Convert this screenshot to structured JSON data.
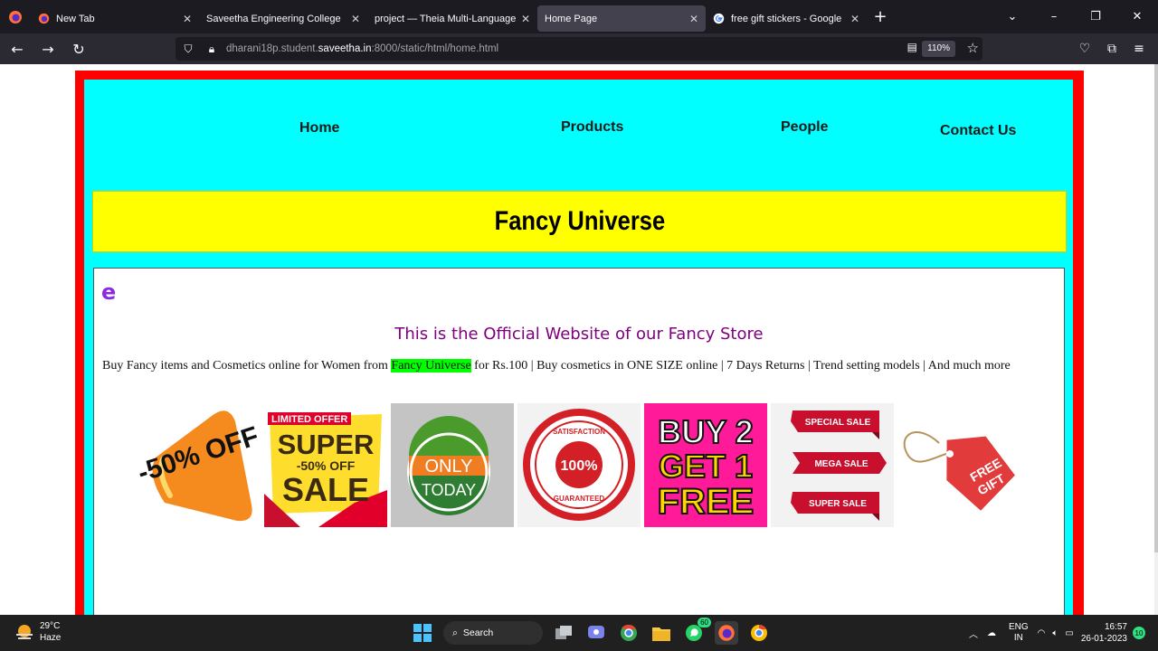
{
  "browser": {
    "tabs": [
      {
        "label": "New Tab",
        "favicon": "firefox-icon"
      },
      {
        "label": "Saveetha Engineering College",
        "favicon": "blank"
      },
      {
        "label": "project — Theia Multi-Language Ex",
        "favicon": "blank"
      },
      {
        "label": "Home Page",
        "favicon": "blank",
        "active": true
      },
      {
        "label": "free gift stickers - Google Searc",
        "favicon": "google-icon"
      }
    ],
    "url_prefix": "dharani18p.student.",
    "url_domain": "saveetha.in",
    "url_suffix": ":8000/static/html/home.html",
    "zoom": "110%"
  },
  "page": {
    "menu": [
      "Home",
      "Products",
      "People",
      "Contact Us"
    ],
    "banner_title": "Fancy Universe",
    "marquee_text": "e",
    "subtitle": "This is the Official Website of our Fancy Store",
    "desc_before": "Buy Fancy items and Cosmetics online for Women from ",
    "desc_highlight": "Fancy Universe",
    "desc_after": " for Rs.100 | Buy cosmetics in ONE SIZE online | 7 Days Returns | Trend setting models | And much more",
    "stickers": {
      "s1": "-50% OFF",
      "s2_top": "LIMITED OFFER",
      "s2_mid": "SUPER",
      "s2_pct": "-50% OFF",
      "s2_bot": "SALE",
      "s3_top": "ONLY",
      "s3_bot": "TODAY",
      "s4_pct": "100%",
      "s4_top": "SATISFACTION",
      "s4_bot": "GUARANTEED",
      "s5_l1": "BUY 2",
      "s5_l2": "GET 1",
      "s5_l3": "FREE",
      "s6_r1": "SPECIAL SALE",
      "s6_r2": "MEGA SALE",
      "s6_r3": "SUPER SALE",
      "s7_l1": "FREE",
      "s7_l2": "GIFT"
    },
    "colors": {
      "frame": "#ff0000",
      "background": "#00ffff",
      "banner": "#ffff00",
      "highlight": "#00ff00"
    }
  },
  "taskbar": {
    "temp": "29°C",
    "weather": "Haze",
    "search_label": "Search",
    "lang_top": "ENG",
    "lang_bottom": "IN",
    "time": "16:57",
    "date": "26-01-2023",
    "whatsapp_badge": "60",
    "notif_count": "10"
  }
}
